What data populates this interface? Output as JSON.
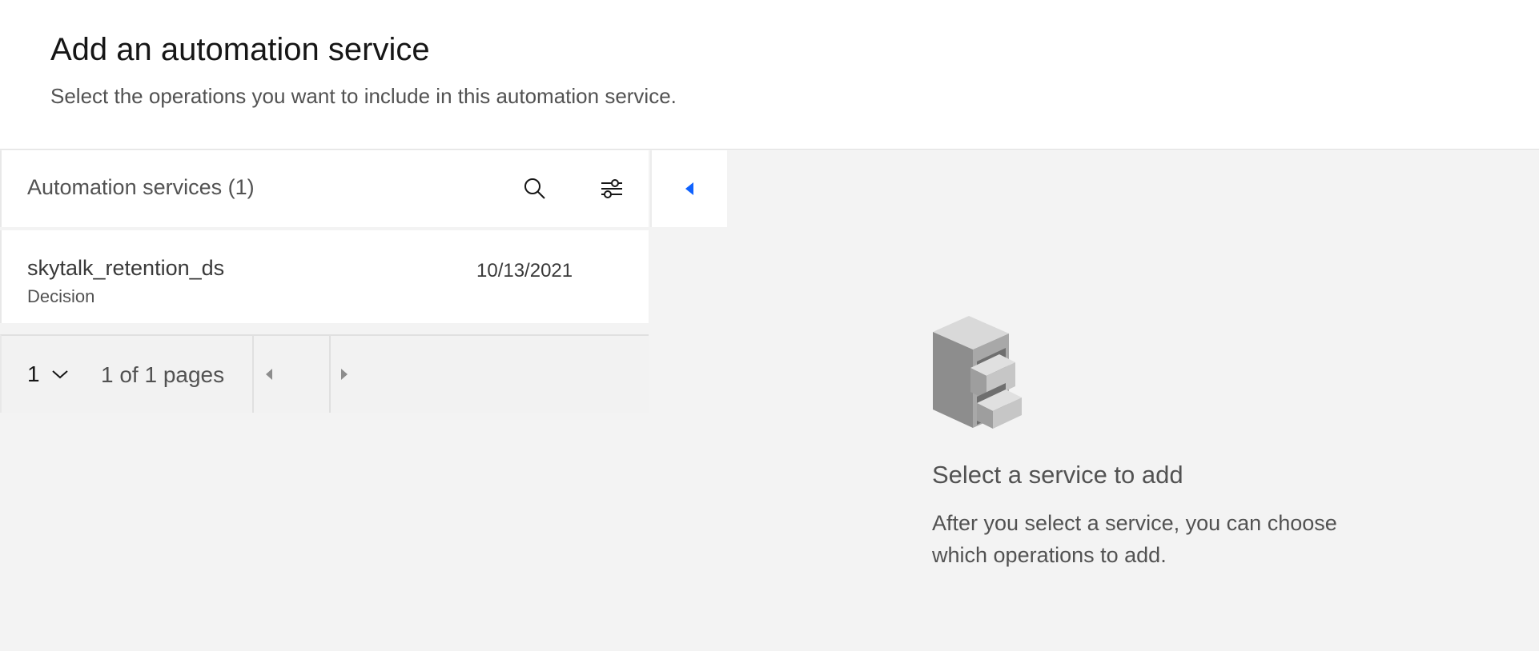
{
  "header": {
    "title": "Add an automation service",
    "subtitle": "Select the operations you want to include in this automation service."
  },
  "list": {
    "title": "Automation services (1)",
    "search_icon": "search-icon",
    "filter_icon": "filter-settings-icon",
    "collapse_icon": "caret-left-icon",
    "accent_color": "#0f62fe",
    "items": [
      {
        "name": "skytalk_retention_ds",
        "type": "Decision",
        "date": "10/13/2021"
      }
    ]
  },
  "pagination": {
    "current_page": "1",
    "page_info": "1 of 1 pages"
  },
  "empty_state": {
    "illustration": "file-cabinet-illustration",
    "title": "Select a service to add",
    "description": "After you select a service, you can choose which operations to add."
  }
}
